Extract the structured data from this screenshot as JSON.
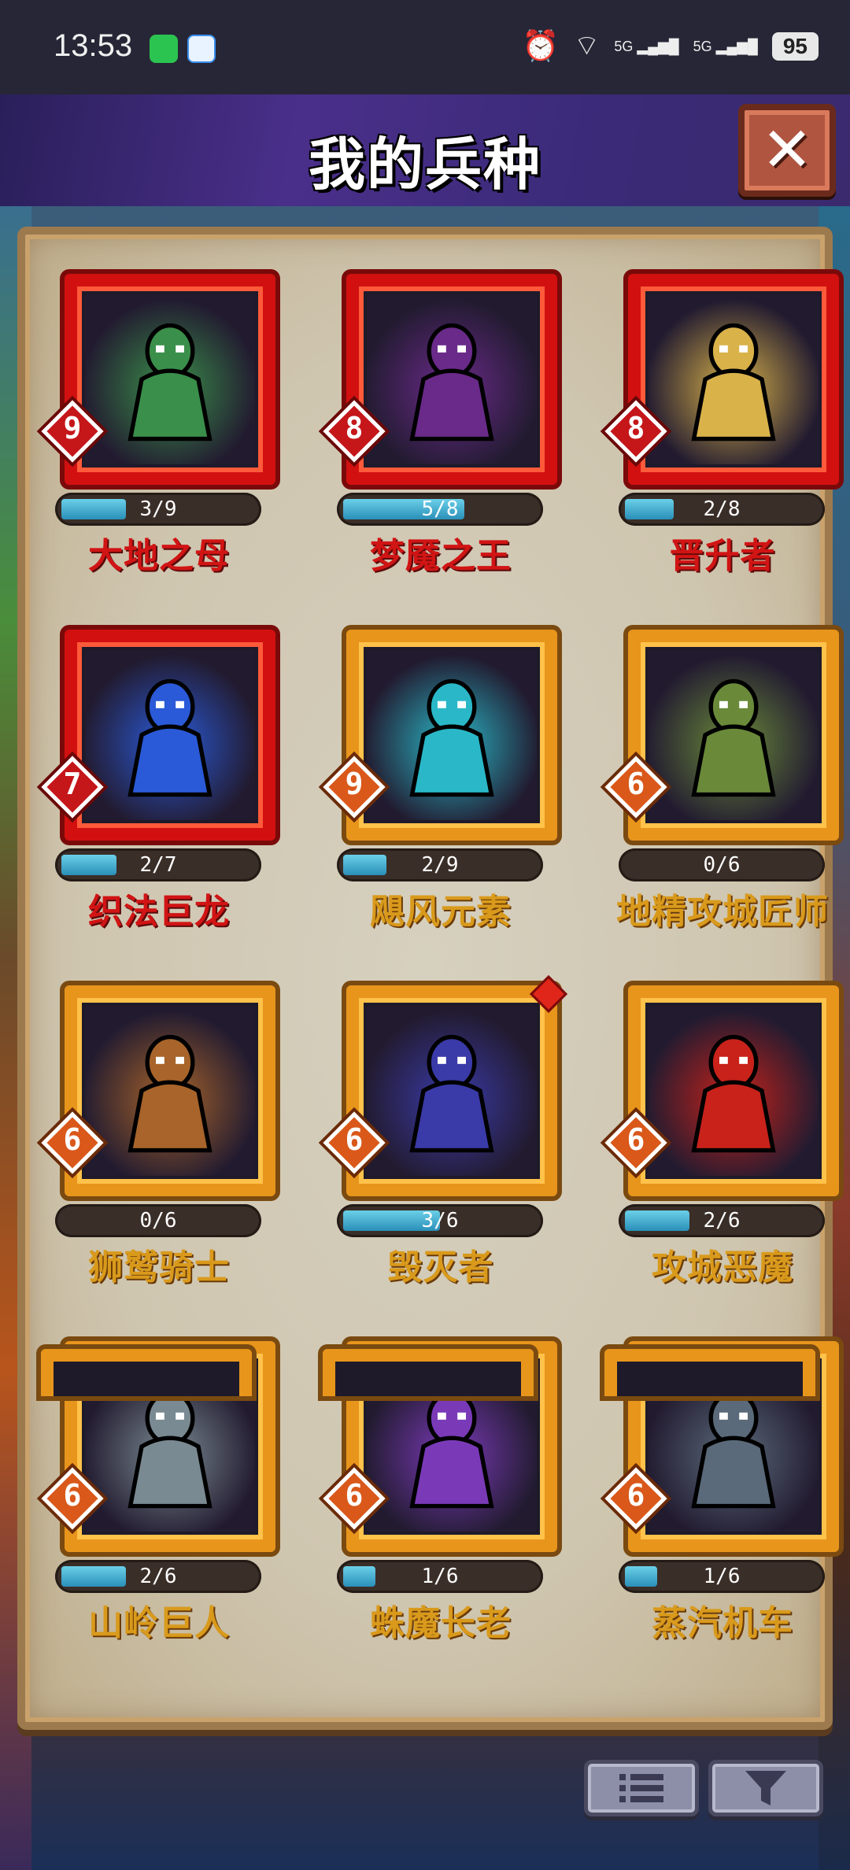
{
  "status_bar": {
    "time": "13:53",
    "signal_1": "5G",
    "signal_2": "5G",
    "battery": "95"
  },
  "header": {
    "title": "我的兵种"
  },
  "units": [
    {
      "name": "大地之母",
      "level": "9",
      "progress": "3/9",
      "frame": "red",
      "color": "#3a8f4a"
    },
    {
      "name": "梦魇之王",
      "level": "8",
      "progress": "5/8",
      "frame": "red",
      "color": "#6a2a8a"
    },
    {
      "name": "晋升者",
      "level": "8",
      "progress": "2/8",
      "frame": "red",
      "color": "#d9b24a"
    },
    {
      "name": "织法巨龙",
      "level": "7",
      "progress": "2/7",
      "frame": "red",
      "color": "#2a5ad8"
    },
    {
      "name": "飓风元素",
      "level": "9",
      "progress": "2/9",
      "frame": "gold",
      "color": "#2ab8c8"
    },
    {
      "name": "地精攻城匠师",
      "level": "6",
      "progress": "0/6",
      "frame": "gold",
      "color": "#6a8a3a"
    },
    {
      "name": "狮鹫骑士",
      "level": "6",
      "progress": "0/6",
      "frame": "gold",
      "color": "#a8642a"
    },
    {
      "name": "毁灭者",
      "level": "6",
      "progress": "3/6",
      "frame": "gold",
      "color": "#3a3aa8"
    },
    {
      "name": "攻城恶魔",
      "level": "6",
      "progress": "2/6",
      "frame": "gold",
      "color": "#c8221a"
    },
    {
      "name": "山岭巨人",
      "level": "6",
      "progress": "2/6",
      "frame": "gold",
      "color": "#7a8a92"
    },
    {
      "name": "蛛魔长老",
      "level": "6",
      "progress": "1/6",
      "frame": "gold",
      "color": "#7a3ab8"
    },
    {
      "name": "蒸汽机车",
      "level": "6",
      "progress": "1/6",
      "frame": "gold",
      "color": "#5a6a7a"
    }
  ],
  "icons": {
    "close": "close-icon",
    "list": "list-icon",
    "filter": "filter-icon"
  }
}
